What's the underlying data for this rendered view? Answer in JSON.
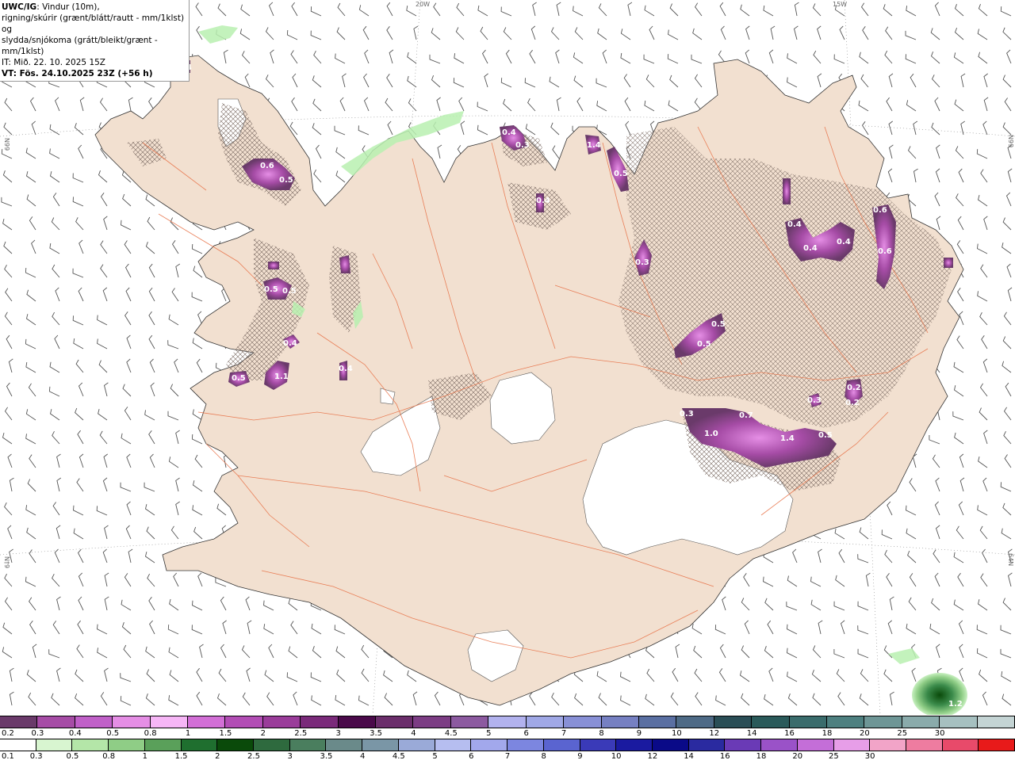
{
  "info": {
    "model": "UWC/IG",
    "line1": ": Vindur (10m),",
    "line2": "rigning/skúrir (grænt/blátt/rautt - mm/1klst) og",
    "line3": "slydda/snjókoma (grátt/bleikt/grænt - mm/1klst)",
    "it": "IT: Mið. 22. 10. 2025 15Z",
    "vt": "VT: Fös. 24.10.2025 23Z (+56 h)"
  },
  "grid_labels": {
    "lon_20w": "20W",
    "lon_15w": "15W",
    "lat_66n_left": "N99",
    "lat_66n_right": "N99",
    "lat_64n_left": "N†9",
    "lat_64n_right": "64N"
  },
  "precip_labels": [
    "0.4",
    "0.6",
    "0.5",
    "0.4",
    "0.3",
    "1.4",
    "0.5",
    "0.4",
    "0.3",
    "0.6",
    "0.4",
    "0.4",
    "0.6",
    "0.4",
    "0.5",
    "0.5",
    "0.5",
    "0.4",
    "1.1",
    "0.5",
    "0.4",
    "0.5",
    "0.3",
    "1.0",
    "0.7",
    "1.4",
    "0.5",
    "0.3",
    "0.2",
    "0.2",
    "1.2"
  ],
  "legend_snow": {
    "colors": [
      "#6a3a6a",
      "#a64ca6",
      "#c060c8",
      "#e58ee5",
      "#f6b6f6",
      "#d26fd6",
      "#b24db5",
      "#9a3c9a",
      "#7a2a7a",
      "#4a0a4a",
      "#6b2e6b",
      "#7c3d84",
      "#8c5aa0",
      "#b2b2ee",
      "#a0a8e6",
      "#8890d6",
      "#7680c2",
      "#5a6fa2",
      "#4e6a86",
      "#2a4e56",
      "#2a5a5a",
      "#3a6c6c",
      "#4e8080",
      "#6e9696",
      "#8aabab",
      "#a6c0c0",
      "#c4d4d4"
    ],
    "labels": [
      "0.2",
      "0.3",
      "0.4",
      "0.5",
      "0.8",
      "1",
      "1.5",
      "2",
      "2.5",
      "3",
      "3.5",
      "4",
      "4.5",
      "5",
      "6",
      "7",
      "8",
      "9",
      "10",
      "12",
      "14",
      "16",
      "18",
      "20",
      "25",
      "30"
    ]
  },
  "legend_rain": {
    "colors": [
      "#ffffff",
      "#d8f5d0",
      "#b4e6a8",
      "#8fcd86",
      "#5aa05a",
      "#1f6f2f",
      "#0a4a0a",
      "#2e6a3e",
      "#4a7e5e",
      "#6a8a8a",
      "#7a96a6",
      "#9aaad8",
      "#b6bef0",
      "#a2a8ec",
      "#7c86e0",
      "#5a64d0",
      "#3a3ab8",
      "#1a1aa0",
      "#0a0a88",
      "#2a2aa0",
      "#6a3ab6",
      "#9a52c8",
      "#c46ed8",
      "#e79ee8",
      "#f2a4c8",
      "#ee7ca0",
      "#e84a6a",
      "#e81a1a"
    ],
    "labels": [
      "0.1",
      "0.3",
      "0.5",
      "0.8",
      "1",
      "1.5",
      "2",
      "2.5",
      "3",
      "3.5",
      "4",
      "4.5",
      "5",
      "6",
      "7",
      "8",
      "9",
      "10",
      "12",
      "14",
      "16",
      "18",
      "20",
      "25",
      "30"
    ]
  }
}
